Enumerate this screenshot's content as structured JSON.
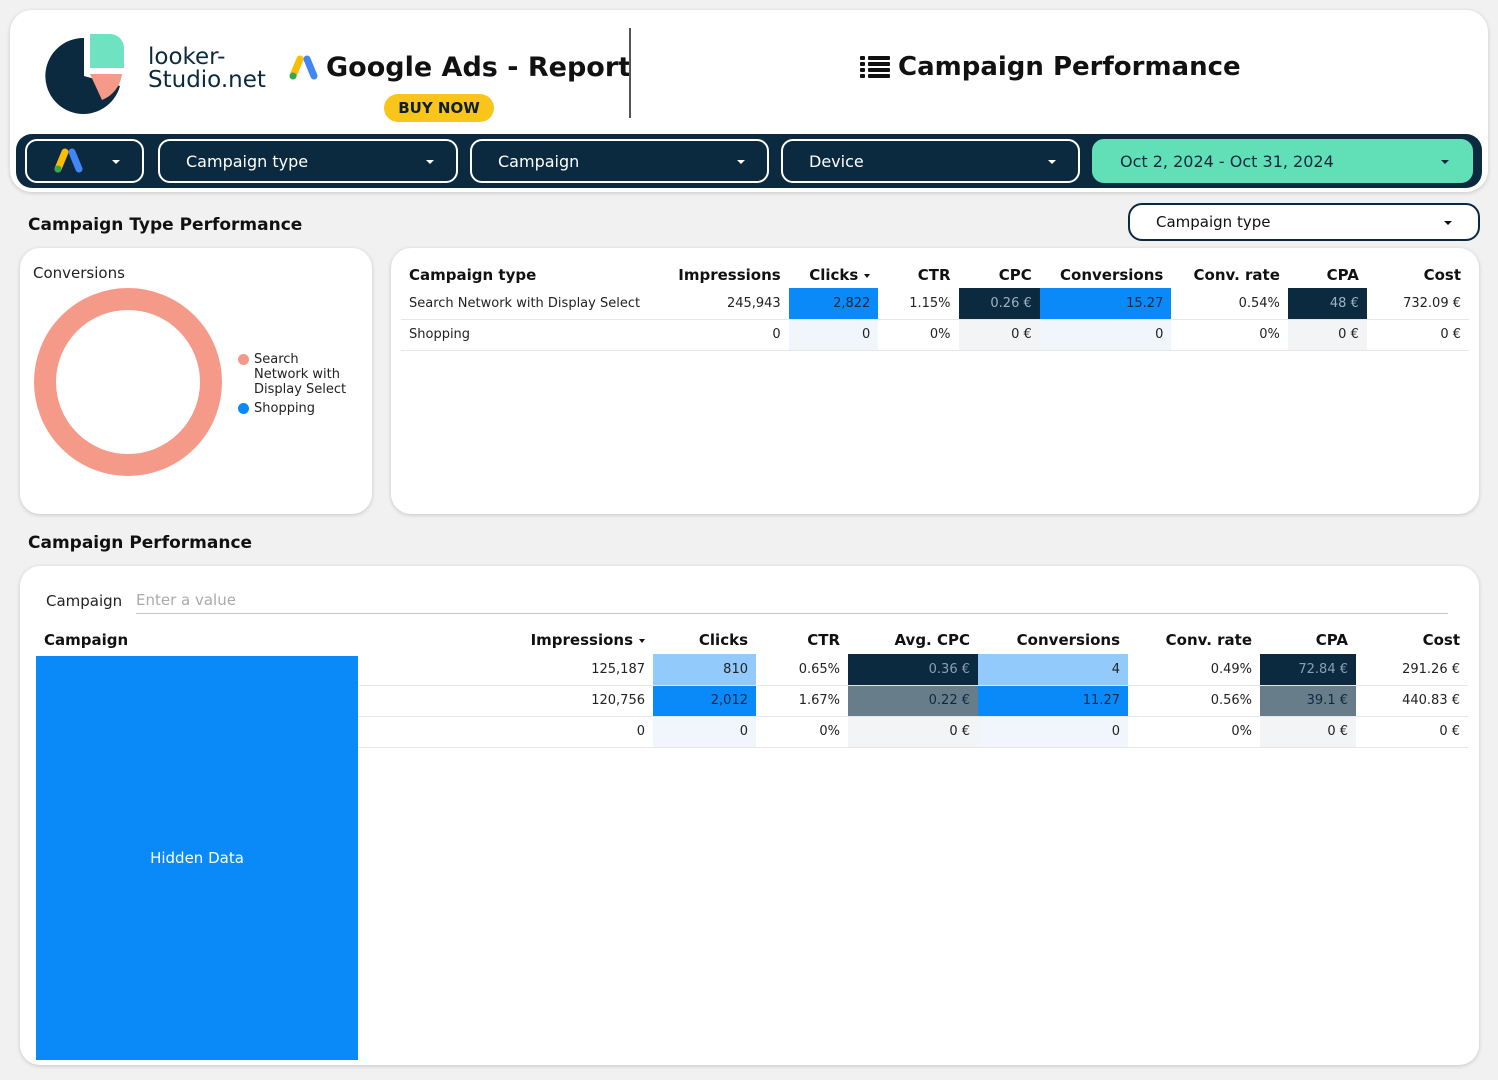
{
  "header": {
    "logo_line1": "looker-",
    "logo_line2": "Studio.net",
    "report_title": "Google Ads - Report",
    "buy_now_label": "BUY NOW",
    "page_title": "Campaign Performance"
  },
  "filters": {
    "campaign_type": "Campaign type",
    "campaign": "Campaign",
    "device": "Device",
    "date_range": "Oct 2, 2024 - Oct 31, 2024"
  },
  "type_section": {
    "title": "Campaign Type Performance",
    "filter_label": "Campaign type",
    "donut_title": "Conversions",
    "legend": [
      {
        "label_line1": "Search",
        "label_line2": "Network with",
        "label_line3": "Display Select",
        "color": "#f59a88"
      },
      {
        "label_line1": "Shopping",
        "label_line2": "",
        "label_line3": "",
        "color": "#0a8af8"
      }
    ],
    "table": {
      "headers": [
        "Campaign type",
        "Impressions",
        "Clicks",
        "CTR",
        "CPC",
        "Conversions",
        "Conv. rate",
        "CPA",
        "Cost"
      ],
      "rows": [
        [
          "Search Network with Display Select",
          "245,943",
          "2,822",
          "1.15%",
          "0.26 €",
          "15.27",
          "0.54%",
          "48 €",
          "732.09 €"
        ],
        [
          "Shopping",
          "0",
          "0",
          "0%",
          "0 €",
          "0",
          "0%",
          "0 €",
          "0 €"
        ]
      ]
    }
  },
  "chart_data": {
    "type": "pie",
    "title": "Conversions",
    "categories": [
      "Search Network with Display Select",
      "Shopping"
    ],
    "values": [
      15.27,
      0
    ],
    "legend_position": "right"
  },
  "campaign_section": {
    "title": "Campaign Performance",
    "search_label": "Campaign",
    "search_placeholder": "Enter a value",
    "hidden_label": "Hidden Data",
    "table": {
      "headers": [
        "Campaign",
        "Impressions",
        "Clicks",
        "CTR",
        "Avg. CPC",
        "Conversions",
        "Conv. rate",
        "CPA",
        "Cost"
      ],
      "rows": [
        [
          "",
          "125,187",
          "810",
          "0.65%",
          "0.36 €",
          "4",
          "0.49%",
          "72.84 €",
          "291.26 €"
        ],
        [
          "",
          "120,756",
          "2,012",
          "1.67%",
          "0.22 €",
          "11.27",
          "0.56%",
          "39.1 €",
          "440.83 €"
        ],
        [
          "",
          "0",
          "0",
          "0%",
          "0 €",
          "0",
          "0%",
          "0 €",
          "0 €"
        ]
      ]
    }
  }
}
